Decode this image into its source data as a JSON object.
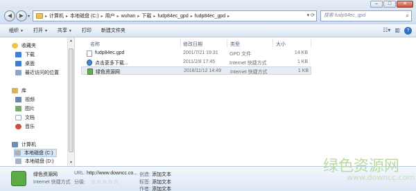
{
  "window": {
    "minimize": "–",
    "maximize": "□",
    "close": "✕"
  },
  "address": {
    "crumbs": [
      "计算机",
      "本地磁盘 (C:)",
      "用户",
      "wuhan",
      "下载",
      "fudp84ec_gpd",
      "fudp84ec_gpd"
    ],
    "separator": "▸",
    "search_placeholder": "搜索 fudp84ec_gpd"
  },
  "toolbar": {
    "organize": "组织",
    "open": "打开",
    "share": "共享",
    "print": "打印",
    "new_folder": "新建文件夹"
  },
  "sidebar": {
    "favorites": "收藏夹",
    "downloads": "下载",
    "desktop": "桌面",
    "recent": "最近访问的位置",
    "libraries": "库",
    "videos": "视频",
    "pictures": "图片",
    "documents": "文档",
    "music": "音乐",
    "computer": "计算机",
    "drive_c": "本地磁盘 (C:)",
    "drive_d": "本地磁盘 (D:)"
  },
  "columns": {
    "name": "名称",
    "date": "修改日期",
    "type": "类型",
    "size": "大小"
  },
  "files": [
    {
      "name": "fudp84ec.gpd",
      "date": "2001/7/21 19:31",
      "type": "GPD 文件",
      "size": "14 KB"
    },
    {
      "name": "点击更多下载...",
      "date": "2011/2/8 17:45",
      "type": "Internet 快捷方式",
      "size": "1 KB"
    },
    {
      "name": "绿色资源网",
      "date": "2018/11/12 14:49",
      "type": "Internet 快捷方式",
      "size": "1 KB"
    }
  ],
  "details": {
    "name": "绿色资源网",
    "type": "Internet 快捷方式",
    "url_label": "URL:",
    "url_value": "http://www.downcc.co...",
    "rating_label": "分级:",
    "stars": "☆☆☆☆☆",
    "created_label": "创造:",
    "created_value": "添加文本",
    "label_label": "标签:",
    "label_value": "添加文本",
    "author_label": "作者:",
    "author_value": "添加文本"
  },
  "watermark": {
    "title": "绿色资源网",
    "url": "www.downcc.com"
  }
}
